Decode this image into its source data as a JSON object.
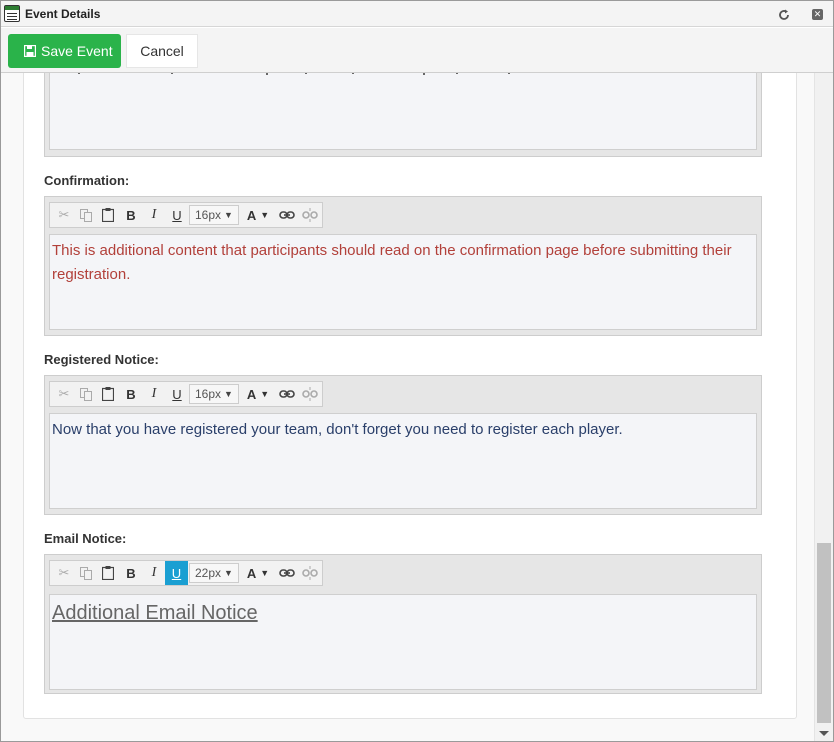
{
  "window": {
    "title": "Event Details"
  },
  "toolbar": {
    "save_label": "Save Event",
    "cancel_label": "Cancel"
  },
  "top_editor": {
    "partial_text": ""
  },
  "editor_tools": {
    "size_options_visible": true
  },
  "fields": [
    {
      "label": "Confirmation:",
      "font_size": "16px",
      "underline_active": false,
      "content": "This is additional content that participants should read on the confirmation page before submitting their registration.",
      "text_color": "#b2403a"
    },
    {
      "label": "Registered Notice:",
      "font_size": "16px",
      "underline_active": false,
      "content": "Now that you have registered your team, don't forget you need to register each player.",
      "text_color": "#2a3f6a"
    },
    {
      "label": "Email Notice:",
      "font_size": "22px",
      "underline_active": true,
      "content": "Additional Email Notice",
      "text_color": "#666666"
    }
  ],
  "colors": {
    "save_button": "#2ab34a",
    "active_tool": "#1a9fd2"
  }
}
